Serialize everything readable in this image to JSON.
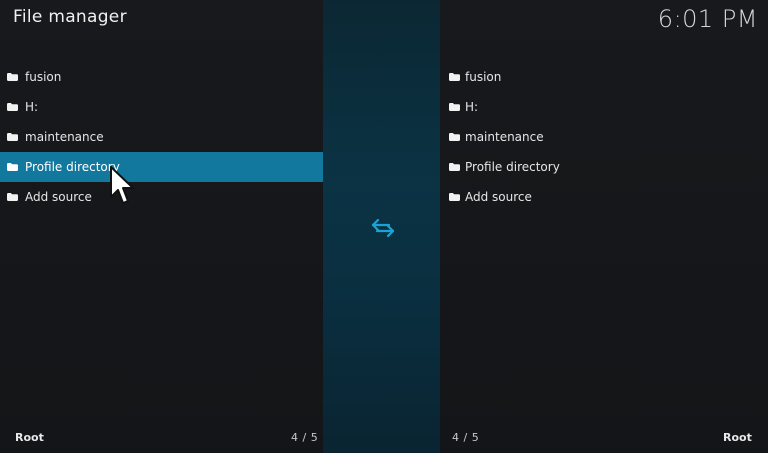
{
  "header": {
    "title": "File manager",
    "clock": "6:01 PM"
  },
  "left_pane": {
    "items": [
      {
        "label": "fusion",
        "icon": "folder-icon"
      },
      {
        "label": "H:",
        "icon": "folder-icon"
      },
      {
        "label": "maintenance",
        "icon": "folder-icon"
      },
      {
        "label": "Profile directory",
        "icon": "folder-icon"
      },
      {
        "label": "Add source",
        "icon": "folder-icon"
      }
    ],
    "selected_index": 3,
    "footer_label": "Root",
    "count": "4 / 5"
  },
  "right_pane": {
    "items": [
      {
        "label": "fusion",
        "icon": "folder-icon"
      },
      {
        "label": "H:",
        "icon": "folder-icon"
      },
      {
        "label": "maintenance",
        "icon": "folder-icon"
      },
      {
        "label": "Profile directory",
        "icon": "folder-icon"
      },
      {
        "label": "Add source",
        "icon": "folder-icon"
      }
    ],
    "footer_label": "Root",
    "count": "4 / 5"
  },
  "center": {
    "icon": "swap-arrows-icon"
  },
  "colors": {
    "selection": "#12789d",
    "accent": "#1aa3d6",
    "background": "#121417"
  }
}
